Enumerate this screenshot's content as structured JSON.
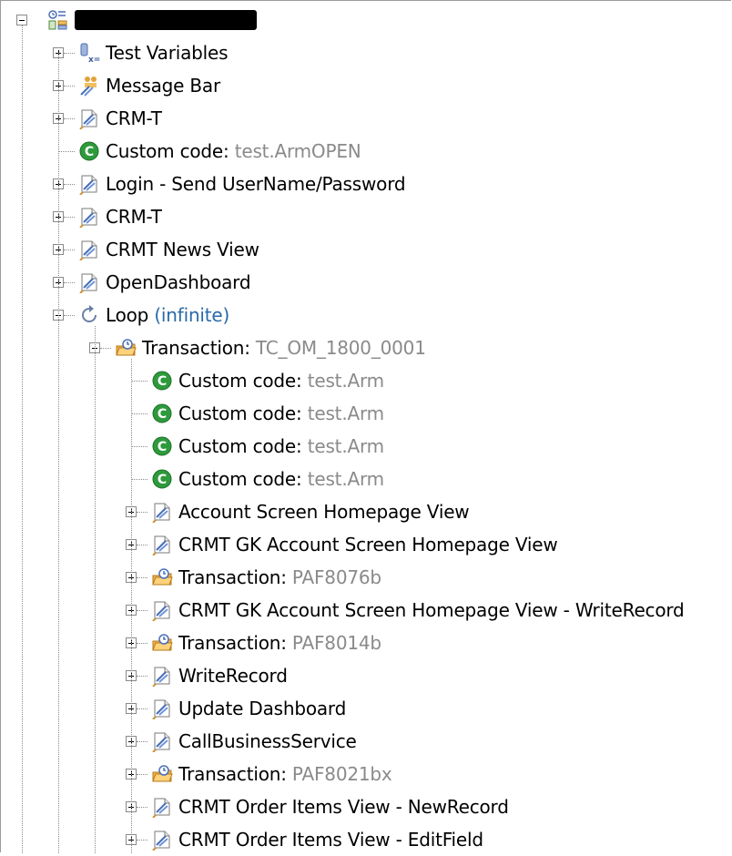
{
  "root": {
    "icon": "test-root-icon",
    "label_redacted": true
  },
  "items": [
    {
      "label": "Test Variables",
      "detail": "",
      "icon": "test-variables-icon",
      "expandable": true,
      "depth": 1
    },
    {
      "label": "Message Bar",
      "detail": "",
      "icon": "message-bar-icon",
      "expandable": true,
      "depth": 1
    },
    {
      "label": "CRM-T",
      "detail": "",
      "icon": "page-icon",
      "expandable": true,
      "depth": 1
    },
    {
      "label": "Custom code: ",
      "detail": "test.ArmOPEN",
      "icon": "custom-code-icon",
      "expandable": false,
      "depth": 1
    },
    {
      "label": "Login - Send UserName/Password",
      "detail": "",
      "icon": "page-icon",
      "expandable": true,
      "depth": 1
    },
    {
      "label": "CRM-T",
      "detail": "",
      "icon": "page-icon",
      "expandable": true,
      "depth": 1
    },
    {
      "label": "CRMT News View",
      "detail": "",
      "icon": "page-icon",
      "expandable": true,
      "depth": 1
    },
    {
      "label": "OpenDashboard",
      "detail": "",
      "icon": "page-icon",
      "expandable": true,
      "depth": 1
    },
    {
      "label": "Loop ",
      "detail": "(infinite)",
      "icon": "loop-icon",
      "expandable": true,
      "expanded": true,
      "depth": 1
    },
    {
      "label": "Transaction: ",
      "detail": "TC_OM_1800_0001",
      "icon": "transaction-icon",
      "expandable": true,
      "expanded": true,
      "depth": 2
    },
    {
      "label": "Custom code: ",
      "detail": "test.Arm",
      "icon": "custom-code-icon",
      "expandable": false,
      "depth": 3
    },
    {
      "label": "Custom code: ",
      "detail": "test.Arm",
      "icon": "custom-code-icon",
      "expandable": false,
      "depth": 3
    },
    {
      "label": "Custom code: ",
      "detail": "test.Arm",
      "icon": "custom-code-icon",
      "expandable": false,
      "depth": 3
    },
    {
      "label": "Custom code: ",
      "detail": "test.Arm",
      "icon": "custom-code-icon",
      "expandable": false,
      "depth": 3
    },
    {
      "label": "Account Screen Homepage View",
      "detail": "",
      "icon": "page-icon",
      "expandable": true,
      "depth": 3
    },
    {
      "label": "CRMT GK Account Screen Homepage View",
      "detail": "",
      "icon": "page-icon",
      "expandable": true,
      "depth": 3
    },
    {
      "label": "Transaction: ",
      "detail": "PAF8076b",
      "icon": "transaction-icon",
      "expandable": true,
      "depth": 3
    },
    {
      "label": "CRMT GK Account Screen Homepage View - WriteRecord",
      "detail": "",
      "icon": "page-icon",
      "expandable": true,
      "depth": 3
    },
    {
      "label": "Transaction: ",
      "detail": "PAF8014b",
      "icon": "transaction-icon",
      "expandable": true,
      "depth": 3
    },
    {
      "label": "WriteRecord",
      "detail": "",
      "icon": "page-icon",
      "expandable": true,
      "depth": 3
    },
    {
      "label": "Update Dashboard",
      "detail": "",
      "icon": "page-icon",
      "expandable": true,
      "depth": 3
    },
    {
      "label": "CallBusinessService",
      "detail": "",
      "icon": "page-icon",
      "expandable": true,
      "depth": 3
    },
    {
      "label": "Transaction: ",
      "detail": "PAF8021bx",
      "icon": "transaction-icon",
      "expandable": true,
      "depth": 3
    },
    {
      "label": "CRMT Order Items View - NewRecord",
      "detail": "",
      "icon": "page-icon",
      "expandable": true,
      "depth": 3
    },
    {
      "label": "CRMT Order Items View - EditField",
      "detail": "",
      "icon": "page-icon",
      "expandable": true,
      "depth": 3
    }
  ],
  "colors": {
    "detail_gray": "#8a8a8a",
    "detail_blue": "#2a6aa8",
    "custom_code_green": "#2e9a3c",
    "transaction_orange": "#f0a030",
    "page_blue": "#4a6fb8"
  }
}
